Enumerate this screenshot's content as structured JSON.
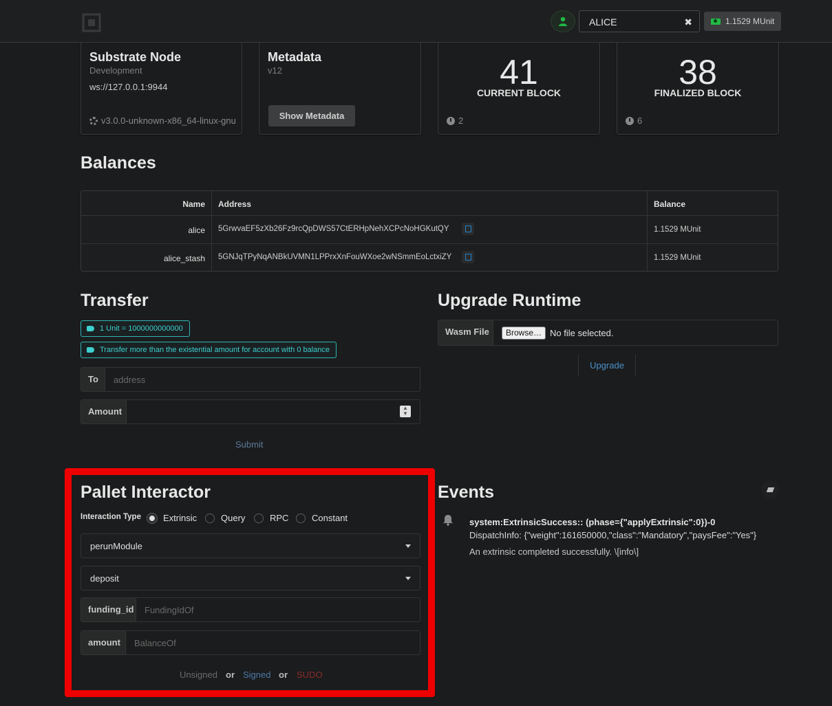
{
  "topbar": {
    "account_name": "ALICE",
    "clear_symbol": "✖",
    "balance": "1.1529 MUnit"
  },
  "node_card": {
    "title": "Substrate Node",
    "meta": "Development",
    "description": "ws://127.0.0.1:9944",
    "version": "v3.0.0-unknown-x86_64-linux-gnu"
  },
  "metadata_card": {
    "title": "Metadata",
    "meta": "v12",
    "button_label": "Show Metadata"
  },
  "current_block": {
    "number": "41",
    "label": "CURRENT BLOCK",
    "timer": "2"
  },
  "finalized_block": {
    "number": "38",
    "label": "FINALIZED BLOCK",
    "timer": "6"
  },
  "balances": {
    "title": "Balances",
    "headers": {
      "name": "Name",
      "address": "Address",
      "balance": "Balance"
    },
    "rows": [
      {
        "name": "alice",
        "address": "5GrwvaEF5zXb26Fz9rcQpDWS57CtERHpNehXCPcNoHGKutQY",
        "balance": "1.1529 MUnit"
      },
      {
        "name": "alice_stash",
        "address": "5GNJqTPyNqANBkUVMN1LPPrxXnFouWXoe2wNSmmEoLctxiZY",
        "balance": "1.1529 MUnit"
      }
    ]
  },
  "transfer": {
    "title": "Transfer",
    "info1": "1 Unit = 1000000000000",
    "info2": "Transfer more than the existential amount for account with 0 balance",
    "to_label": "To",
    "to_placeholder": "address",
    "amount_label": "Amount",
    "submit_label": "Submit"
  },
  "upgrade": {
    "title": "Upgrade Runtime",
    "wasm_label": "Wasm File",
    "browse_label": "Browse…",
    "no_file": "No file selected.",
    "upgrade_label": "Upgrade"
  },
  "pallet": {
    "title": "Pallet Interactor",
    "interaction_label": "Interaction Type",
    "options": [
      "Extrinsic",
      "Query",
      "RPC",
      "Constant"
    ],
    "selected": "Extrinsic",
    "module": "perunModule",
    "call": "deposit",
    "param1_label": "funding_id",
    "param1_placeholder": "FundingIdOf",
    "param2_label": "amount",
    "param2_placeholder": "BalanceOf",
    "unsigned": "Unsigned",
    "or": "or",
    "signed": "Signed",
    "sudo": "SUDO"
  },
  "events": {
    "title": "Events",
    "items": [
      {
        "title": "system:ExtrinsicSuccess:: (phase={\"applyExtrinsic\":0})-0",
        "info": "DispatchInfo: {\"weight\":161650000,\"class\":\"Mandatory\",\"paysFee\":\"Yes\"}",
        "desc": "An extrinsic completed successfully. \\[info\\]"
      }
    ]
  },
  "colors": {
    "highlight": "#ee0000",
    "teal": "#3ecfcf",
    "link": "#4a90c8",
    "sudo": "#8b2a2a"
  }
}
